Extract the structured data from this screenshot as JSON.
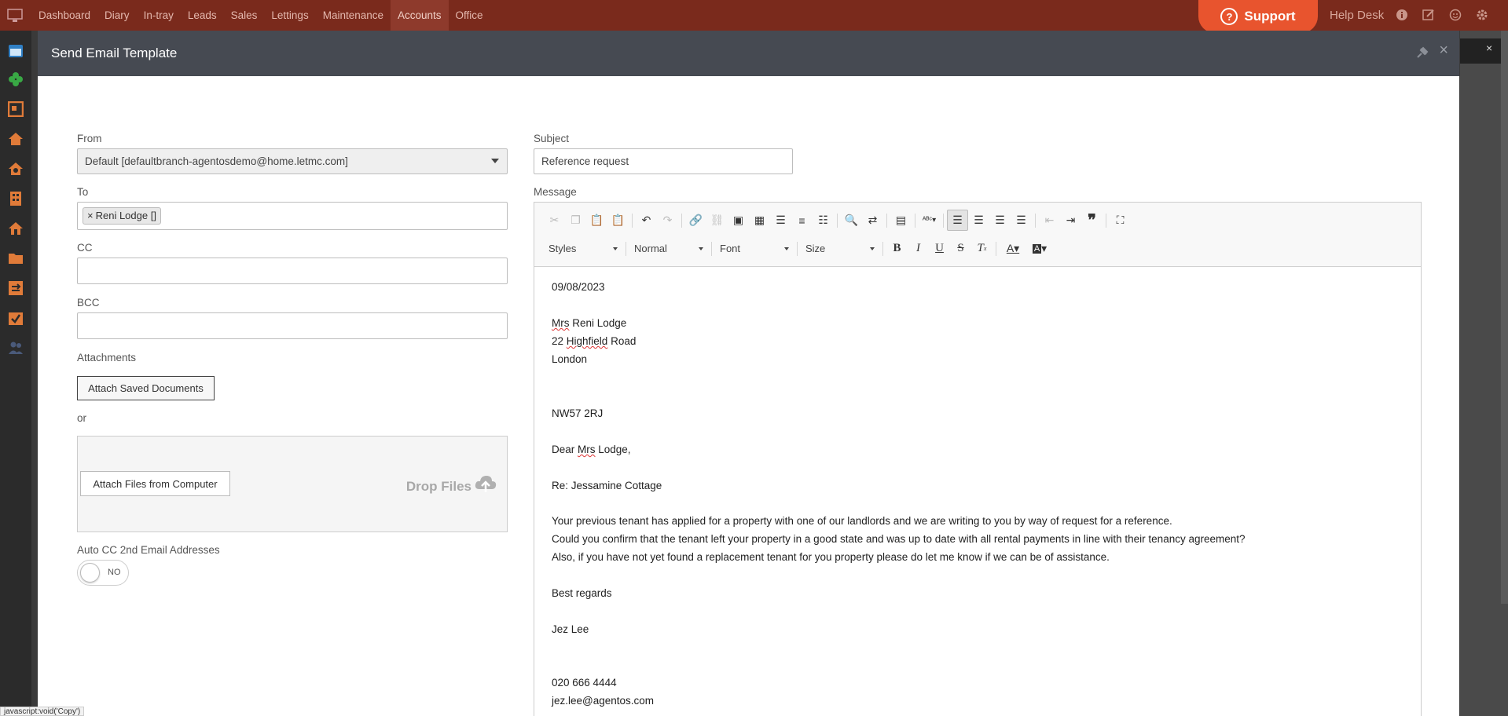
{
  "topnav": {
    "items": [
      {
        "label": "Dashboard"
      },
      {
        "label": "Diary"
      },
      {
        "label": "In-tray"
      },
      {
        "label": "Leads"
      },
      {
        "label": "Sales"
      },
      {
        "label": "Lettings"
      },
      {
        "label": "Maintenance"
      },
      {
        "label": "Accounts",
        "active": true
      },
      {
        "label": "Office"
      }
    ],
    "support_label": "Support",
    "helpdesk_label": "Help Desk",
    "icons": [
      "info-icon",
      "edit-icon",
      "smiley-icon",
      "settings-icon"
    ],
    "bar_color": "#7a2a1c",
    "support_color": "#e8542e"
  },
  "sidebar": {
    "icons": [
      "calendar-icon",
      "flower-icon",
      "contact-card-icon",
      "house-icon",
      "house-search-icon",
      "building-icon",
      "house-tools-icon",
      "folder-icon",
      "exchange-icon",
      "checklist-icon",
      "users-icon"
    ],
    "accent": "#e07b39"
  },
  "modal": {
    "title": "Send Email Template",
    "from": {
      "label": "From",
      "value": "Default [defaultbranch-agentosdemo@home.letmc.com]"
    },
    "to": {
      "label": "To",
      "tags": [
        "Reni Lodge []"
      ]
    },
    "cc": {
      "label": "CC",
      "value": ""
    },
    "bcc": {
      "label": "BCC",
      "value": ""
    },
    "attachments": {
      "label": "Attachments",
      "saved_button": "Attach Saved Documents",
      "or_label": "or",
      "computer_button": "Attach Files from Computer",
      "drop_label": "Drop Files"
    },
    "auto_cc": {
      "label": "Auto CC 2nd Email Addresses",
      "toggle_text": "NO",
      "on": false
    },
    "subject": {
      "label": "Subject",
      "value": "Reference request"
    },
    "message": {
      "label": "Message",
      "toolbar": {
        "styles": "Styles",
        "format": "Normal",
        "font": "Font",
        "size": "Size"
      },
      "lines": {
        "date": "09/08/2023",
        "name_title": "Mrs",
        "name_rest": " Reni Lodge",
        "addr1_num": "22 ",
        "addr1_word": "Highfield",
        "addr1_rest": " Road",
        "addr2": "London",
        "postcode": "NW57 2RJ",
        "greeting_pre": "Dear ",
        "greeting_title": "Mrs",
        "greeting_post": " Lodge,",
        "re": "Re: Jessamine Cottage",
        "para1": "Your previous tenant has applied for a property with one of our landlords and we are writing to you by way of request for a reference.",
        "para2": "Could you confirm that the tenant left your property in a good state and was up to date with all rental payments in line with their tenancy agreement?",
        "para3": "Also, if you have not yet found a replacement tenant for you property please do let me know if we can be of assistance.",
        "signoff": "Best regards",
        "signature": "Jez Lee",
        "phone": "020 666 4444",
        "email": "jez.lee@agentos.com"
      }
    }
  },
  "status_text": "javascript:void('Copy')"
}
